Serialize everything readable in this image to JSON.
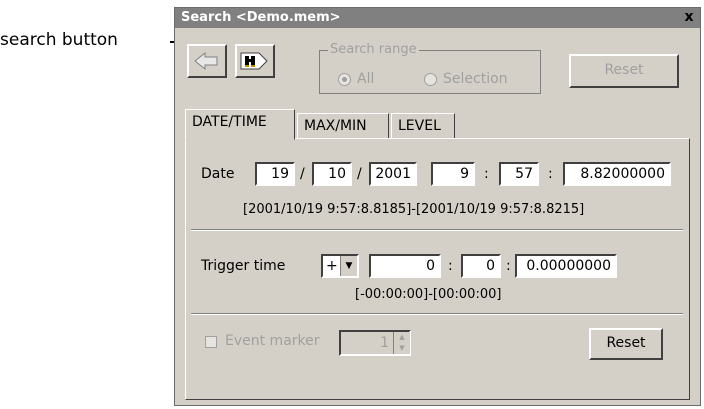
{
  "annotation": {
    "label": "search button"
  },
  "window": {
    "title": "Search <Demo.mem>",
    "close_glyph": "x"
  },
  "toolbar": {
    "back_icon": "back-arrow-icon",
    "search_icon": "binoculars-icon"
  },
  "search_range": {
    "title": "Search range",
    "options": [
      {
        "label": "All",
        "selected": true
      },
      {
        "label": "Selection",
        "selected": false
      }
    ],
    "reset_label": "Reset"
  },
  "tabs": [
    {
      "label": "DATE/TIME",
      "active": true
    },
    {
      "label": "MAX/MIN",
      "active": false
    },
    {
      "label": "LEVEL",
      "active": false
    }
  ],
  "date": {
    "label": "Date",
    "day": "19",
    "sep1": "/",
    "month": "10",
    "sep2": "/",
    "year": "2001",
    "hour": "9",
    "colon1": ":",
    "minute": "57",
    "colon2": ":",
    "second": "8.82000000",
    "range": "[2001/10/19 9:57:8.8185]-[2001/10/19 9:57:8.8215]"
  },
  "trigger": {
    "label": "Trigger time",
    "sign": "+",
    "hours": "0",
    "colon1": ":",
    "minutes": "0",
    "colon2": ":",
    "seconds": "0.00000000",
    "range": "[-00:00:00]-[00:00:00]"
  },
  "event_marker": {
    "label": "Event marker",
    "value": "1",
    "checked": false
  },
  "reset_bottom": {
    "label": "Reset"
  },
  "colors": {
    "dialog_bg": "#d4d0c8",
    "titlebar": "#808080",
    "disabled_text": "#a0a0a0"
  }
}
